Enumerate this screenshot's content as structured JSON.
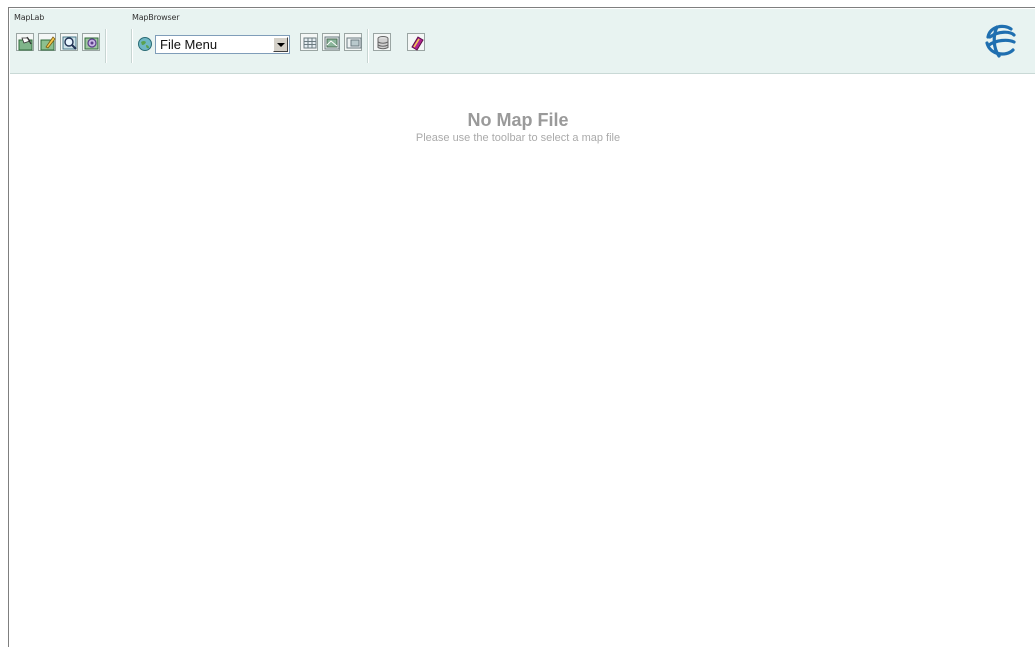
{
  "toolbar": {
    "groups": {
      "maplab_label": "MapLab",
      "mapbrowser_label": "MapBrowser"
    },
    "file_menu": {
      "selected": "File Menu"
    },
    "icons": [
      "map-edit-icon",
      "map-paint-icon",
      "map-zoom-icon",
      "map-settings-icon",
      "globe-icon",
      "grid-view-icon",
      "map-window-icon",
      "map-panel-icon",
      "database-icon",
      "book-icon"
    ],
    "accent_color": "#e8f3f1",
    "logo_color": "#1f6fb0"
  },
  "main": {
    "title": "No Map File",
    "subtitle": "Please use the toolbar to select a map file"
  }
}
